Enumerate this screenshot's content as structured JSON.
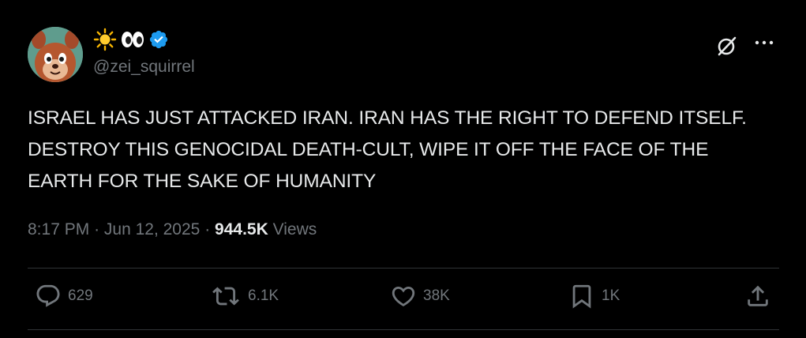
{
  "post": {
    "handle": "@zei_squirrel",
    "display_name_icons": [
      "sun-emoji",
      "eyes-emoji",
      "verified-badge"
    ],
    "text": "ISRAEL HAS JUST ATTACKED IRAN. IRAN HAS THE RIGHT TO DEFEND ITSELF. DESTROY THIS GENOCIDAL DEATH-CULT, WIPE IT OFF THE FACE OF THE EARTH FOR THE SAKE OF HUMANITY",
    "time": "8:17 PM",
    "separator": "·",
    "date": "Jun 12, 2025",
    "views_count": "944.5K",
    "views_label": "Views"
  },
  "actions": {
    "replies": "629",
    "reposts": "6.1K",
    "likes": "38K",
    "bookmarks": "1K"
  },
  "colors": {
    "background": "#000000",
    "text": "#e7e9ea",
    "secondary": "#71767b",
    "divider": "#2f3336",
    "verified": "#1d9bf0"
  }
}
